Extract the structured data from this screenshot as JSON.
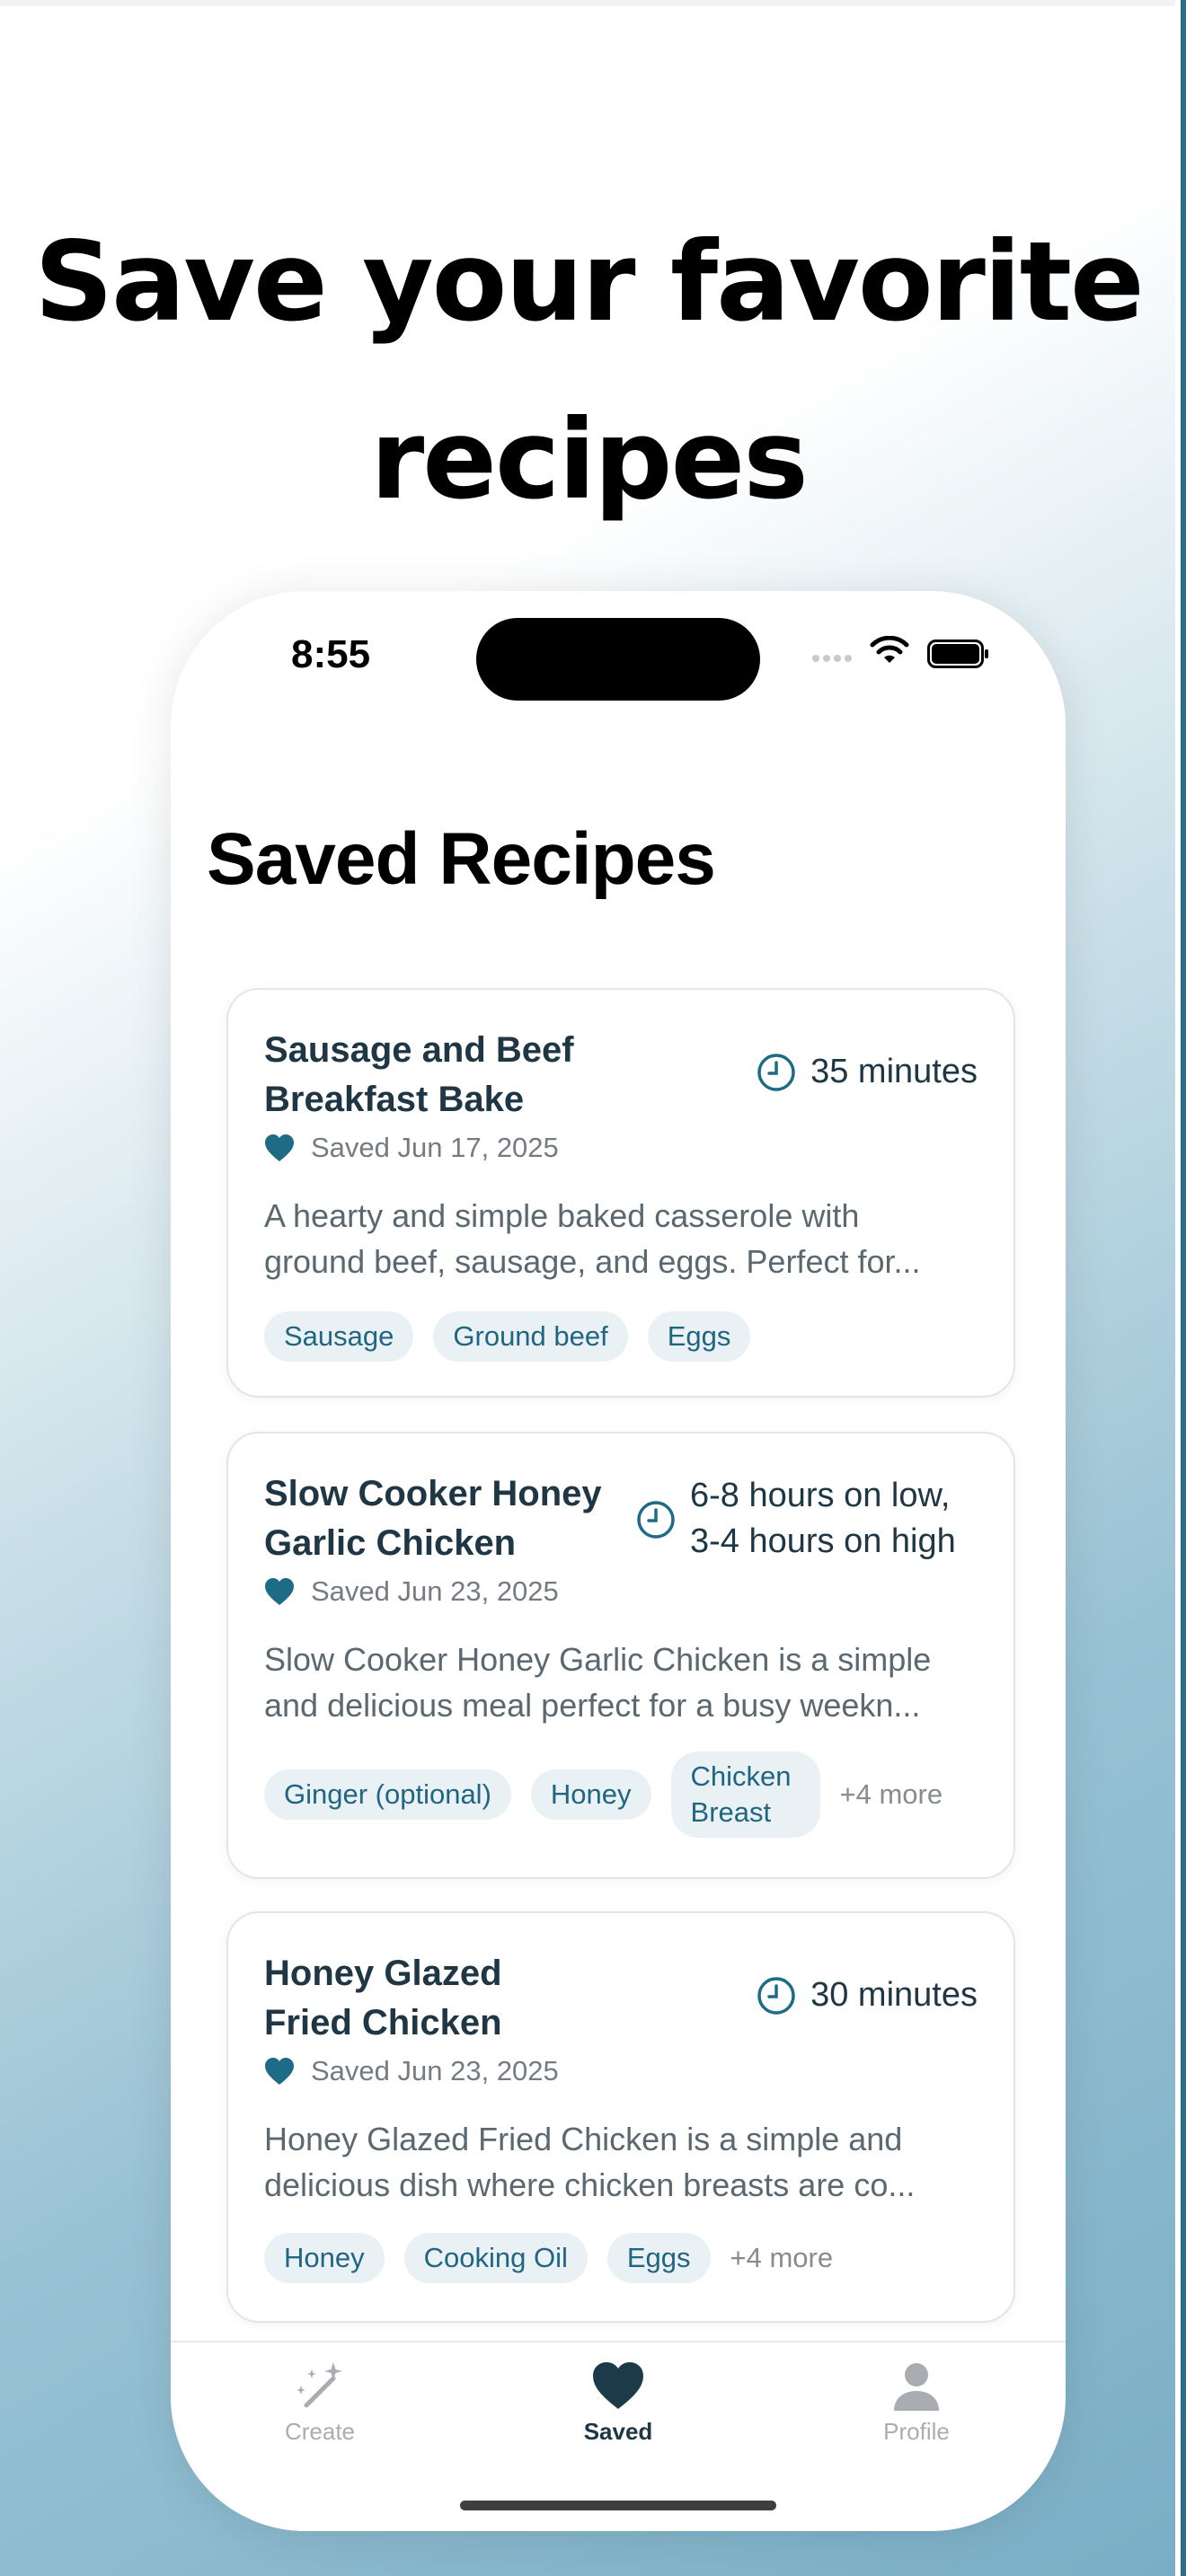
{
  "headline": {
    "line1": "Save your favorite",
    "line2": "recipes"
  },
  "status_bar": {
    "time": "8:55"
  },
  "page_title": "Saved Recipes",
  "recipes": [
    {
      "title_line1": "Sausage and Beef",
      "title_line2": "Breakfast Bake",
      "time": "35 minutes",
      "saved": "Saved Jun 17, 2025",
      "desc_line1": "A hearty and simple baked casserole with",
      "desc_line2": "ground beef, sausage, and eggs. Perfect for...",
      "tags": [
        "Sausage",
        "Ground beef",
        "Eggs"
      ]
    },
    {
      "title_line1": "Slow Cooker Honey",
      "title_line2": "Garlic Chicken",
      "time_line1": "6-8 hours on low,",
      "time_line2": "3-4 hours on high",
      "saved": "Saved Jun 23, 2025",
      "desc_line1": "Slow Cooker Honey Garlic Chicken is a simple",
      "desc_line2": "and delicious meal perfect for a busy weekn...",
      "tags": [
        "Ginger (optional)",
        "Honey",
        "Chicken Breast"
      ],
      "more": "+4 more"
    },
    {
      "title_line1": "Honey Glazed",
      "title_line2": "Fried Chicken",
      "time": "30 minutes",
      "saved": "Saved Jun 23, 2025",
      "desc_line1": "Honey Glazed Fried Chicken is a simple and",
      "desc_line2": "delicious dish where chicken breasts are co...",
      "tags": [
        "Honey",
        "Cooking Oil",
        "Eggs"
      ],
      "more": "+4 more"
    }
  ],
  "tabs": [
    {
      "label": "Create",
      "icon": "magic-wand-icon",
      "active": false
    },
    {
      "label": "Saved",
      "icon": "heart-icon",
      "active": true
    },
    {
      "label": "Profile",
      "icon": "person-icon",
      "active": false
    }
  ],
  "colors": {
    "accent": "#1e6b87",
    "title_text": "#1f3644",
    "chip_bg": "#e9f1f5",
    "chip_text": "#206681"
  }
}
